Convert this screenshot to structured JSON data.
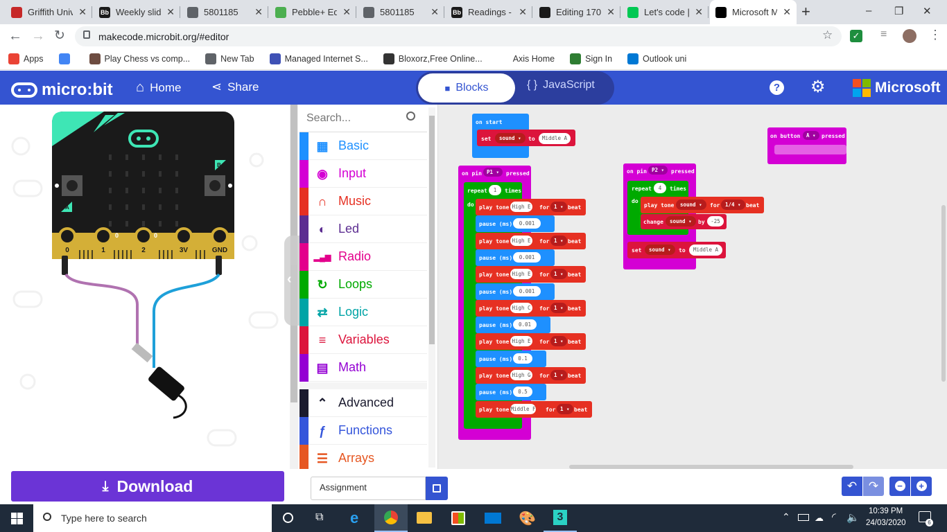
{
  "browser": {
    "tabs": [
      {
        "title": "Griffith Univ",
        "fav_color": "#c62828",
        "fav_text": "",
        "active": false
      },
      {
        "title": "Weekly slid",
        "fav_color": "#1a1a1a",
        "fav_text": "Bb",
        "active": false
      },
      {
        "title": "5801185",
        "fav_color": "#5f6368",
        "fav_text": "",
        "active": false
      },
      {
        "title": "Pebble+ Ed",
        "fav_color": "#4caf50",
        "fav_text": "",
        "active": false
      },
      {
        "title": "5801185",
        "fav_color": "#5f6368",
        "fav_text": "",
        "active": false
      },
      {
        "title": "Readings -",
        "fav_color": "#1a1a1a",
        "fav_text": "Bb",
        "active": false
      },
      {
        "title": "Editing 170",
        "fav_color": "#1a1a1a",
        "fav_text": "",
        "active": false
      },
      {
        "title": "Let's code |",
        "fav_color": "#00c853",
        "fav_text": "",
        "active": false
      },
      {
        "title": "Microsoft M",
        "fav_color": "#000000",
        "fav_text": "",
        "active": true
      }
    ],
    "new_tab": "+",
    "window_controls": {
      "minimize": "–",
      "maximize": "❐",
      "close": "✕"
    },
    "url": "makecode.microbit.org/#editor",
    "bookmarks": [
      {
        "label": "Apps",
        "color": "#ea4335"
      },
      {
        "label": "",
        "color": "#4285f4"
      },
      {
        "label": "Play Chess vs comp...",
        "color": "#6d4c41"
      },
      {
        "label": "New Tab",
        "color": "#5f6368"
      },
      {
        "label": "Managed Internet S...",
        "color": "#3f51b5"
      },
      {
        "label": "Bloxorz,Free Online...",
        "color": "#333333"
      },
      {
        "label": "Axis Home",
        "color": "#ffffff"
      },
      {
        "label": "Sign In",
        "color": "#2e7d32"
      },
      {
        "label": "Outlook uni",
        "color": "#0078d4"
      }
    ]
  },
  "makecode": {
    "logo": "micro:bit",
    "home": "Home",
    "share": "Share",
    "blocks_tab": "Blocks",
    "js_tab": "JavaScript",
    "brand": "Microsoft"
  },
  "simulator": {
    "pin_labels": [
      "0",
      "1",
      "2",
      "3V",
      "GND"
    ],
    "button_a": "A",
    "button_b": "B",
    "pin_small": [
      "0",
      "0"
    ]
  },
  "toolbox": {
    "search_placeholder": "Search...",
    "categories": [
      {
        "label": "Basic",
        "color": "#1e90ff",
        "icon": "grid-icon"
      },
      {
        "label": "Input",
        "color": "#d400d4",
        "icon": "target-icon"
      },
      {
        "label": "Music",
        "color": "#e63022",
        "icon": "headphones-icon"
      },
      {
        "label": "Led",
        "color": "#5c2d91",
        "icon": "toggle-icon"
      },
      {
        "label": "Radio",
        "color": "#e3008c",
        "icon": "signal-icon"
      },
      {
        "label": "Loops",
        "color": "#00aa00",
        "icon": "refresh-icon"
      },
      {
        "label": "Logic",
        "color": "#00a4a6",
        "icon": "shuffle-icon"
      },
      {
        "label": "Variables",
        "color": "#dc143c",
        "icon": "list-icon"
      },
      {
        "label": "Math",
        "color": "#9400d3",
        "icon": "calculator-icon"
      },
      {
        "label": "Advanced",
        "color": "#1a1a2e",
        "icon": "chevron-up-icon"
      },
      {
        "label": "Functions",
        "color": "#3455db",
        "icon": "function-icon"
      },
      {
        "label": "Arrays",
        "color": "#e65722",
        "icon": "array-icon"
      }
    ]
  },
  "workspace": {
    "on_start": {
      "header": "on start",
      "set": "set",
      "var": "sound",
      "to": "to",
      "value": "Middle A"
    },
    "pin_p1": {
      "on": "on pin",
      "pin": "P1",
      "pressed": "pressed",
      "repeat": "repeat",
      "times_val": "1",
      "times": "times",
      "do": "do",
      "statements": [
        {
          "kind": "tone",
          "note": "High E",
          "beats": "1",
          "unit": "beat"
        },
        {
          "kind": "pause",
          "value": "0.001"
        },
        {
          "kind": "tone",
          "note": "High E",
          "beats": "1",
          "unit": "beat"
        },
        {
          "kind": "pause",
          "value": "0.001"
        },
        {
          "kind": "tone",
          "note": "High E",
          "beats": "1",
          "unit": "beat"
        },
        {
          "kind": "pause",
          "value": "0.001"
        },
        {
          "kind": "tone",
          "note": "High C",
          "beats": "1",
          "unit": "beat"
        },
        {
          "kind": "pause",
          "value": "0.01"
        },
        {
          "kind": "tone",
          "note": "High E",
          "beats": "1",
          "unit": "beat"
        },
        {
          "kind": "pause",
          "value": "0.1"
        },
        {
          "kind": "tone",
          "note": "High G",
          "beats": "1",
          "unit": "beat"
        },
        {
          "kind": "pause",
          "value": "0.5"
        },
        {
          "kind": "tone",
          "note": "Middle F",
          "beats": "1",
          "unit": "beat"
        }
      ],
      "play_tone": "play tone",
      "for": "for",
      "pause": "pause (ms)"
    },
    "pin_p2": {
      "on": "on pin",
      "pin": "P2",
      "pressed": "pressed",
      "repeat": "repeat",
      "times_val": "4",
      "times": "times",
      "do": "do",
      "play_tone": "play tone",
      "note_var": "sound",
      "for": "for",
      "beat_frac": "1/4",
      "unit": "beat",
      "change": "change",
      "change_var": "sound",
      "by": "by",
      "by_val": "-25",
      "set": "set",
      "set_var": "sound",
      "to": "to",
      "set_val": "Middle A"
    },
    "on_button": {
      "on": "on button",
      "btn": "A",
      "pressed": "pressed"
    }
  },
  "bottom": {
    "download": "Download",
    "project_name": "Assignment"
  },
  "taskbar": {
    "search_placeholder": "Type here to search",
    "time": "10:39 PM",
    "date": "24/03/2020",
    "notifications": "6"
  }
}
